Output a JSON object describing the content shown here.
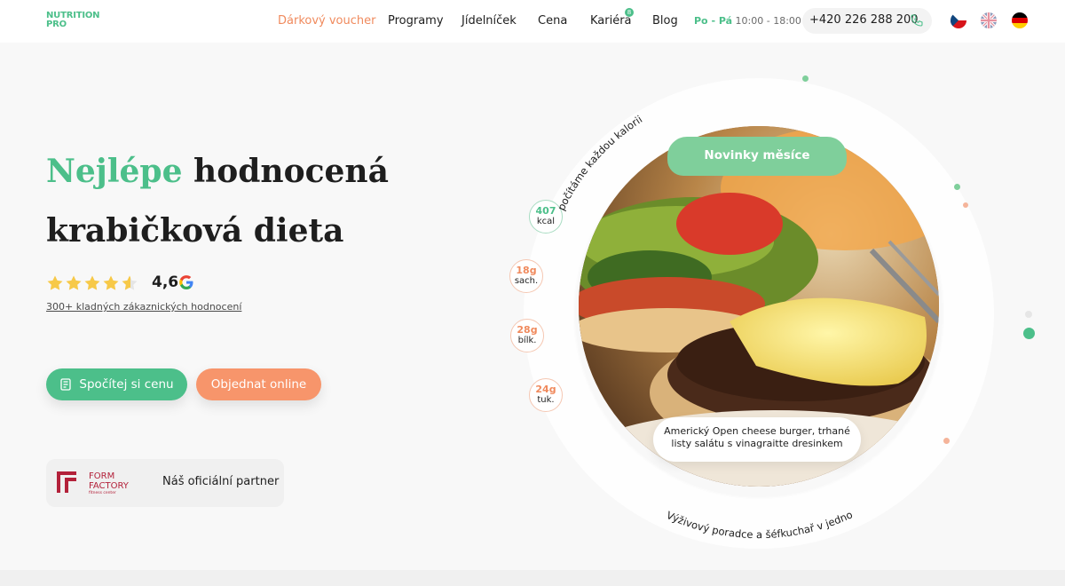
{
  "brand": {
    "logo_line1": "NUTRITION",
    "logo_line2": "PRO"
  },
  "nav": {
    "voucher": "Dárkový voucher",
    "programs": "Programy",
    "menu": "Jídelníček",
    "price": "Cena",
    "career": "Kariéra",
    "career_badge": "8",
    "blog": "Blog"
  },
  "hours": {
    "days": "Po - Pá",
    "time": "10:00 - 18:00"
  },
  "phone": "+420 226 288 200",
  "languages": [
    "czech-flag-icon",
    "uk-flag-icon",
    "german-flag-icon"
  ],
  "hero": {
    "headline_accent": "Nejlépe",
    "headline_rest1": "hodnocená",
    "headline_line2": "krabičková dieta",
    "rating": "4,6",
    "rating_stars": 4.5,
    "reviews_link": "300+ kladných zákaznických hodnocení",
    "btn_calc": "Spočítej si cenu",
    "btn_order": "Objednat online",
    "partner_logo_top": "FORM",
    "partner_logo_mid": "FACTORY",
    "partner_logo_sub": "fitness center",
    "partner_text": "Náš oficiální partner"
  },
  "showcase": {
    "arc_top": "počítáme každou kalorii",
    "arc_bottom": "Výživový poradce a šéfkuchař v jednom",
    "badge": "Novinky měsíce",
    "caption": "Americký Open cheese burger, trhané listy salátu s vinagraitte dresinkem",
    "macros": [
      {
        "value": "407",
        "unit": "kcal"
      },
      {
        "value": "18g",
        "unit": "sach."
      },
      {
        "value": "28g",
        "unit": "bílk."
      },
      {
        "value": "24g",
        "unit": "tuk."
      }
    ]
  },
  "colors": {
    "green": "#4cbf8a",
    "orange": "#f7956b",
    "text": "#1e1e1e"
  }
}
